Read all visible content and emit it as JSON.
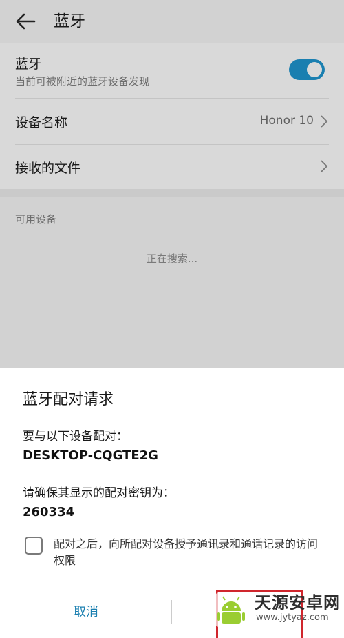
{
  "header": {
    "title": "蓝牙"
  },
  "bluetooth": {
    "label": "蓝牙",
    "subtitle": "当前可被附近的蓝牙设备发现",
    "enabled": true,
    "accent_color": "#1a7fb0"
  },
  "device_name": {
    "label": "设备名称",
    "value": "Honor 10"
  },
  "received_files": {
    "label": "接收的文件"
  },
  "available_devices": {
    "header": "可用设备",
    "status": "正在搜索..."
  },
  "dialog": {
    "title": "蓝牙配对请求",
    "pair_prompt": "要与以下设备配对：",
    "device": "DESKTOP-CQGTE2G",
    "key_prompt": "请确保其显示的配对密钥为：",
    "passkey": "260334",
    "consent_checked": false,
    "consent_text": "配对之后，向所配对设备授予通讯录和通话记录的访问权限",
    "cancel_label": "取消",
    "pair_label": ""
  },
  "watermark": {
    "name": "天源安卓网",
    "url": "www.jytyaz.com"
  }
}
